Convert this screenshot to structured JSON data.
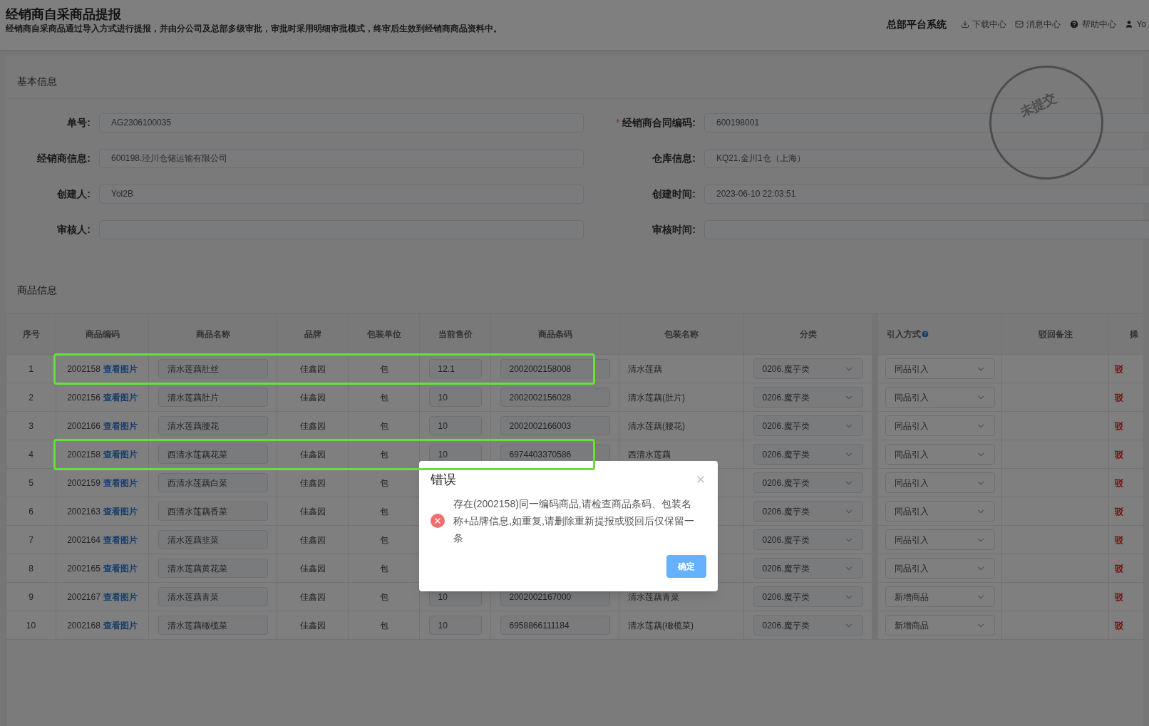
{
  "header": {
    "title": "经销商自采商品提报",
    "description": "经销商自采商品通过导入方式进行提报，并由分公司及总部多级审批，审批时采用明细审批模式，终审后生效到经销商商品资料中。",
    "system_name": "总部平台系统",
    "links": [
      {
        "kind": "download",
        "label": "下载中心"
      },
      {
        "kind": "mail",
        "label": "消息中心"
      },
      {
        "kind": "help",
        "label": "帮助中心"
      },
      {
        "kind": "user",
        "label": "Yo"
      }
    ]
  },
  "basic_info": {
    "title": "基本信息",
    "stamp": "未提交",
    "fields": [
      {
        "label": "单号:",
        "value": "AG2306100035"
      },
      {
        "label": "经销商合同编码:",
        "value": "600198001",
        "required_mark": "*"
      },
      {
        "label": "经销商信息:",
        "value": "600198.泾川仓储运输有限公司"
      },
      {
        "label": "仓库信息:",
        "value": "KQ21.金川1仓（上海）"
      },
      {
        "label": "创建人:",
        "value": "Yol2B"
      },
      {
        "label": "创建时间:",
        "value": "2023-06-10 22:03:51"
      },
      {
        "label": "审核人:"
      },
      {
        "label": "审核时间:"
      }
    ]
  },
  "goods": {
    "title": "商品信息",
    "columns": [
      "序号",
      "商品编码",
      "商品名称",
      "品牌",
      "包装单位",
      "当前售价",
      "商品条码",
      "包装名称",
      "分类",
      "引入方式",
      "驳回备注",
      "操"
    ],
    "rows": [
      {
        "index": "1",
        "code": "2002158",
        "link": "查看图片",
        "name": "清水莲藕肚丝",
        "brand": "佳鑫园",
        "unit": "包",
        "price": "12.1",
        "barcode": "2002002158008",
        "package_name": "清水莲藕",
        "category": "0206.魔芋类",
        "import_method": "同品引入",
        "action": "驳",
        "highlighted": true
      },
      {
        "index": "2",
        "code": "2002156",
        "link": "查看图片",
        "name": "清水莲藕肚片",
        "brand": "佳鑫园",
        "unit": "包",
        "price": "10",
        "barcode": "2002002156028",
        "package_name": "清水莲藕(肚片)",
        "category": "0206.魔芋类",
        "import_method": "同品引入",
        "action": "驳",
        "highlighted": false
      },
      {
        "index": "3",
        "code": "2002166",
        "link": "查看图片",
        "name": "清水莲藕腰花",
        "brand": "佳鑫园",
        "unit": "包",
        "price": "10",
        "barcode": "2002002166003",
        "package_name": "清水莲藕(腰花)",
        "category": "0206.魔芋类",
        "import_method": "同品引入",
        "action": "驳",
        "highlighted": false
      },
      {
        "index": "4",
        "code": "2002158",
        "link": "查看图片",
        "name": "西清水莲藕花菜",
        "brand": "佳鑫园",
        "unit": "包",
        "price": "10",
        "barcode": "6974403370586",
        "package_name": "西清水莲藕",
        "category": "0206.魔芋类",
        "import_method": "同品引入",
        "action": "驳",
        "highlighted": true
      },
      {
        "index": "5",
        "code": "2002159",
        "link": "查看图片",
        "name": "西清水莲藕白菜",
        "brand": "佳鑫园",
        "unit": "包",
        "category": "0206.魔芋类",
        "import_method": "同品引入",
        "action": "驳",
        "highlighted": false
      },
      {
        "index": "6",
        "code": "2002163",
        "link": "查看图片",
        "name": "西清水莲藕香菜",
        "brand": "佳鑫园",
        "unit": "包",
        "category": "0206.魔芋类",
        "import_method": "同品引入",
        "action": "驳",
        "highlighted": false
      },
      {
        "index": "7",
        "code": "2002164",
        "link": "查看图片",
        "name": "清水莲藕韭菜",
        "brand": "佳鑫园",
        "unit": "包",
        "category": "0206.魔芋类",
        "import_method": "同品引入",
        "action": "驳",
        "highlighted": false
      },
      {
        "index": "8",
        "code": "2002165",
        "link": "查看图片",
        "name": "清水莲藕黄花菜",
        "brand": "佳鑫园",
        "unit": "包",
        "category": "0206.魔芋类",
        "import_method": "同品引入",
        "action": "驳",
        "highlighted": false
      },
      {
        "index": "9",
        "code": "2002167",
        "link": "查看图片",
        "name": "清水莲藕青菜",
        "brand": "佳鑫园",
        "unit": "包",
        "price": "10",
        "barcode": "2002002167000",
        "package_name": "清水莲藕青菜",
        "category": "0206.魔芋类",
        "import_method": "新增商品",
        "action": "驳",
        "highlighted": false
      },
      {
        "index": "10",
        "code": "2002168",
        "link": "查看图片",
        "name": "清水莲藕橄榄菜",
        "brand": "佳鑫园",
        "unit": "包",
        "price": "10",
        "barcode": "6958866111184",
        "package_name": "清水莲藕(橄榄菜)",
        "category": "0206.魔芋类",
        "import_method": "新增商品",
        "action": "驳",
        "highlighted": false
      }
    ]
  },
  "dialog": {
    "title": "错误",
    "message": "存在(2002158)同一编码商品,请检查商品条码、包装名称+品牌信息,如重复,请删除重新提报或驳回后仅保留一条",
    "confirm": "确定"
  }
}
